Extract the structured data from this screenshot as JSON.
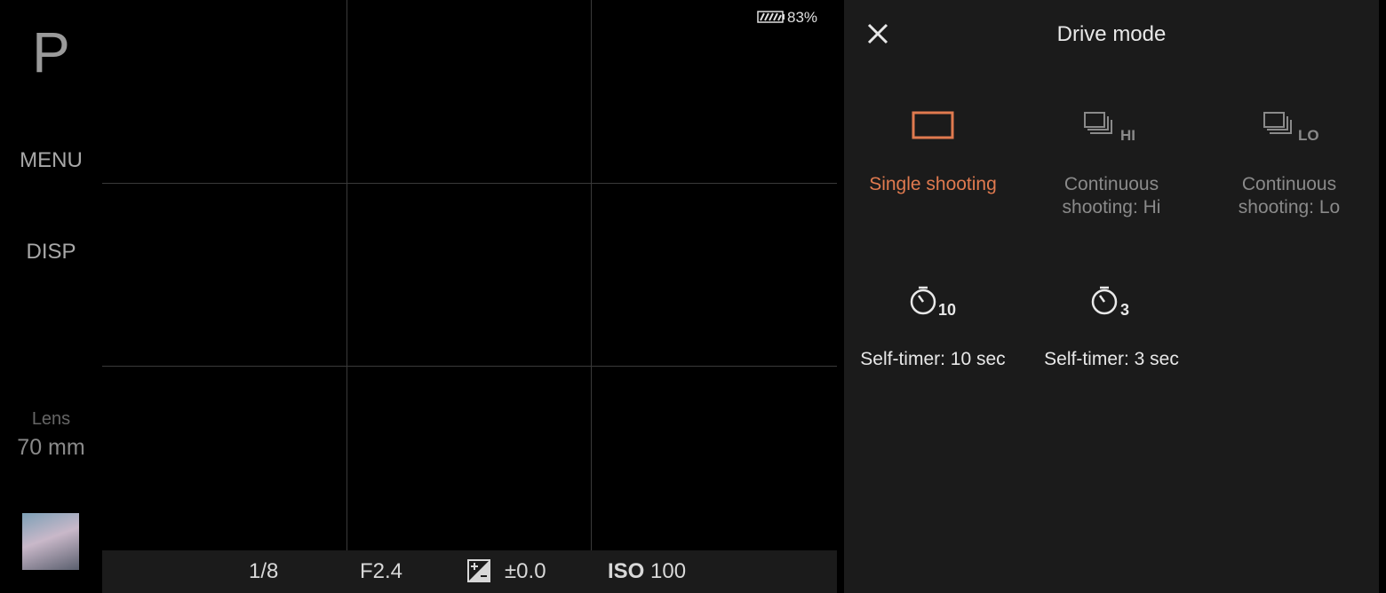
{
  "left_bar": {
    "mode": "P",
    "menu_label": "MENU",
    "disp_label": "DISP",
    "lens_label": "Lens",
    "lens_value": "70 mm"
  },
  "status": {
    "battery_percent": "83%"
  },
  "exposure": {
    "shutter": "1/8",
    "aperture": "F2.4",
    "ev": "±0.0",
    "iso_label": "ISO",
    "iso_value": "100"
  },
  "drive_panel": {
    "title": "Drive mode",
    "options": [
      {
        "label": "Single shooting",
        "selected": true
      },
      {
        "label": "Continuous\nshooting: Hi",
        "badge": "HI"
      },
      {
        "label": "Continuous\nshooting: Lo",
        "badge": "LO"
      },
      {
        "label": "Self-timer: 10 sec",
        "badge": "10"
      },
      {
        "label": "Self-timer: 3 sec",
        "badge": "3"
      }
    ]
  },
  "colors": {
    "accent": "#e07a4f",
    "dimmed": "#8a8a8a",
    "panel_bg": "#1b1b1b"
  }
}
